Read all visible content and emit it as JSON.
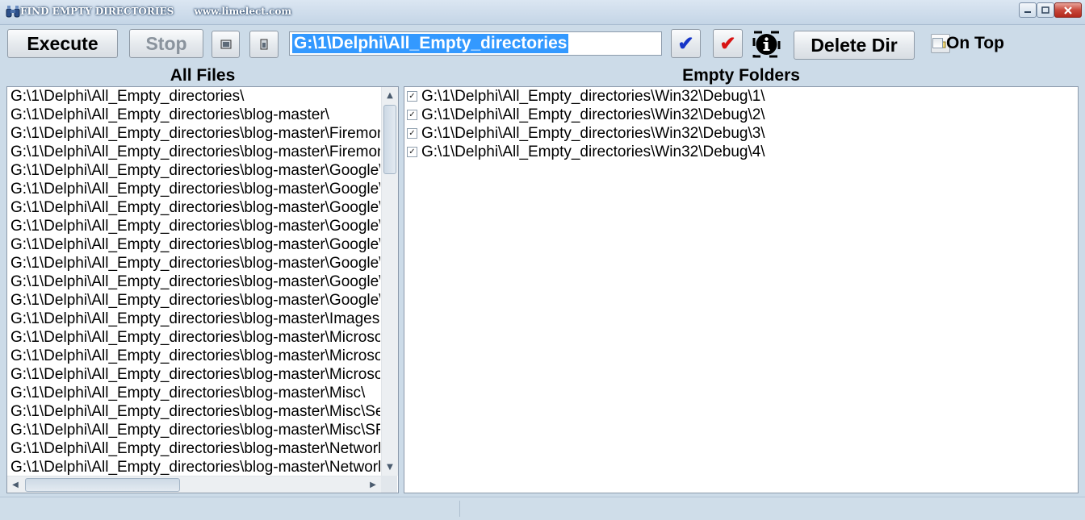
{
  "window": {
    "title": "FIND EMPTY DIRECTORIES",
    "website": "www.limelect.com"
  },
  "toolbar": {
    "execute_label": "Execute",
    "stop_label": "Stop",
    "path_value": "G:\\1\\Delphi\\All_Empty_directories",
    "delete_label": "Delete Dir",
    "on_top_label": "On Top",
    "on_top_checked": false,
    "check_blue_icon": "checkmark-blue",
    "check_red_icon": "checkmark-red",
    "info_icon": "info",
    "browse_icon": "folder"
  },
  "left_panel": {
    "header": "All Files",
    "items": [
      "G:\\1\\Delphi\\All_Empty_directories\\",
      "G:\\1\\Delphi\\All_Empty_directories\\blog-master\\",
      "G:\\1\\Delphi\\All_Empty_directories\\blog-master\\Firemon",
      "G:\\1\\Delphi\\All_Empty_directories\\blog-master\\Firemon",
      "G:\\1\\Delphi\\All_Empty_directories\\blog-master\\Google\\",
      "G:\\1\\Delphi\\All_Empty_directories\\blog-master\\Google\\",
      "G:\\1\\Delphi\\All_Empty_directories\\blog-master\\Google\\",
      "G:\\1\\Delphi\\All_Empty_directories\\blog-master\\Google\\",
      "G:\\1\\Delphi\\All_Empty_directories\\blog-master\\Google\\",
      "G:\\1\\Delphi\\All_Empty_directories\\blog-master\\Google\\",
      "G:\\1\\Delphi\\All_Empty_directories\\blog-master\\Google\\",
      "G:\\1\\Delphi\\All_Empty_directories\\blog-master\\Google\\",
      "G:\\1\\Delphi\\All_Empty_directories\\blog-master\\Images",
      "G:\\1\\Delphi\\All_Empty_directories\\blog-master\\Microso",
      "G:\\1\\Delphi\\All_Empty_directories\\blog-master\\Microso",
      "G:\\1\\Delphi\\All_Empty_directories\\blog-master\\Microso",
      "G:\\1\\Delphi\\All_Empty_directories\\blog-master\\Misc\\",
      "G:\\1\\Delphi\\All_Empty_directories\\blog-master\\Misc\\Se",
      "G:\\1\\Delphi\\All_Empty_directories\\blog-master\\Misc\\SF",
      "G:\\1\\Delphi\\All_Empty_directories\\blog-master\\Networl",
      "G:\\1\\Delphi\\All_Empty_directories\\blog-master\\Networl"
    ]
  },
  "right_panel": {
    "header": "Empty Folders",
    "items": [
      {
        "label": "G:\\1\\Delphi\\All_Empty_directories\\Win32\\Debug\\1\\",
        "checked": true
      },
      {
        "label": "G:\\1\\Delphi\\All_Empty_directories\\Win32\\Debug\\2\\",
        "checked": true
      },
      {
        "label": "G:\\1\\Delphi\\All_Empty_directories\\Win32\\Debug\\3\\",
        "checked": true
      },
      {
        "label": "G:\\1\\Delphi\\All_Empty_directories\\Win32\\Debug\\4\\",
        "checked": true
      }
    ]
  },
  "colors": {
    "window_bg": "#ccdbe8",
    "selection": "#3399ff",
    "check_blue": "#1534c8",
    "check_red": "#d81414"
  }
}
